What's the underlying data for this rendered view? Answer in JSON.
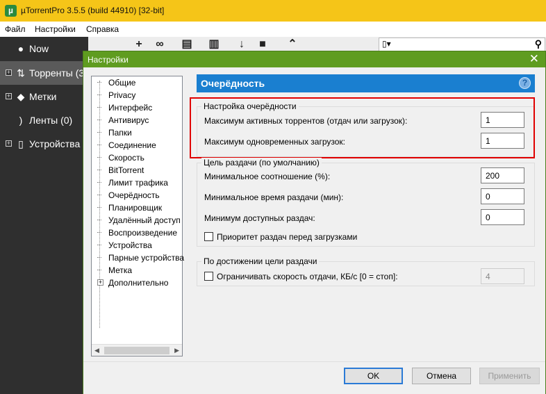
{
  "window": {
    "title": "µTorrentPro 3.5.5  (build 44910) [32-bit]"
  },
  "menu": [
    "Файл",
    "Настройки",
    "Справка"
  ],
  "sidebar": {
    "items": [
      {
        "label": "Now",
        "icon": "now-icon",
        "expander": false
      },
      {
        "label": "Торренты (3",
        "icon": "torrents-icon",
        "expander": true
      },
      {
        "label": "Метки",
        "icon": "tag-icon",
        "expander": true
      },
      {
        "label": "Ленты (0)",
        "icon": "rss-icon",
        "expander": false
      },
      {
        "label": "Устройства (",
        "icon": "device-icon",
        "expander": true
      }
    ]
  },
  "dialog": {
    "title": "Настройки",
    "tree": [
      "Общие",
      "Privacy",
      "Интерфейс",
      "Антивирус",
      "Папки",
      "Соединение",
      "Скорость",
      "BitTorrent",
      "Лимит трафика",
      "Очерёдность",
      "Планировщик",
      "Удалённый доступ",
      "Воспроизведение",
      "Устройства",
      "Парные устройства",
      "Метка",
      "Дополнительно"
    ],
    "selected_tree_item": "Очерёдность",
    "page_title": "Очерёдность",
    "help": "?",
    "queue_group": {
      "label": "Настройка очерёдности",
      "max_active_label": "Максимум активных торрентов (отдач или загрузок):",
      "max_active_value": "1",
      "max_downloads_label": "Максимум одновременных загрузок:",
      "max_downloads_value": "1"
    },
    "seed_group": {
      "label": "Цель раздачи (по умолчанию)",
      "min_ratio_label": "Минимальное соотношение (%):",
      "min_ratio_value": "200",
      "min_time_label": "Минимальное время раздачи (мин):",
      "min_time_value": "0",
      "min_seeds_label": "Минимум доступных раздач:",
      "min_seeds_value": "0",
      "priority_label": "Приоритет раздач перед загрузками",
      "priority_checked": false
    },
    "goal_group": {
      "label": "По достижении цели раздачи",
      "limit_label": "Ограничивать скорость отдачи, КБ/с [0 = стоп]:",
      "limit_checked": false,
      "limit_value": "4"
    },
    "buttons": {
      "ok": "OK",
      "cancel": "Отмена",
      "apply": "Применить"
    }
  },
  "colors": {
    "titlebar": "#f5c518",
    "dialog_title": "#5f9c20",
    "page_header": "#1a7fd0",
    "sidebar": "#2f2f2f",
    "highlight": "#e00000"
  }
}
